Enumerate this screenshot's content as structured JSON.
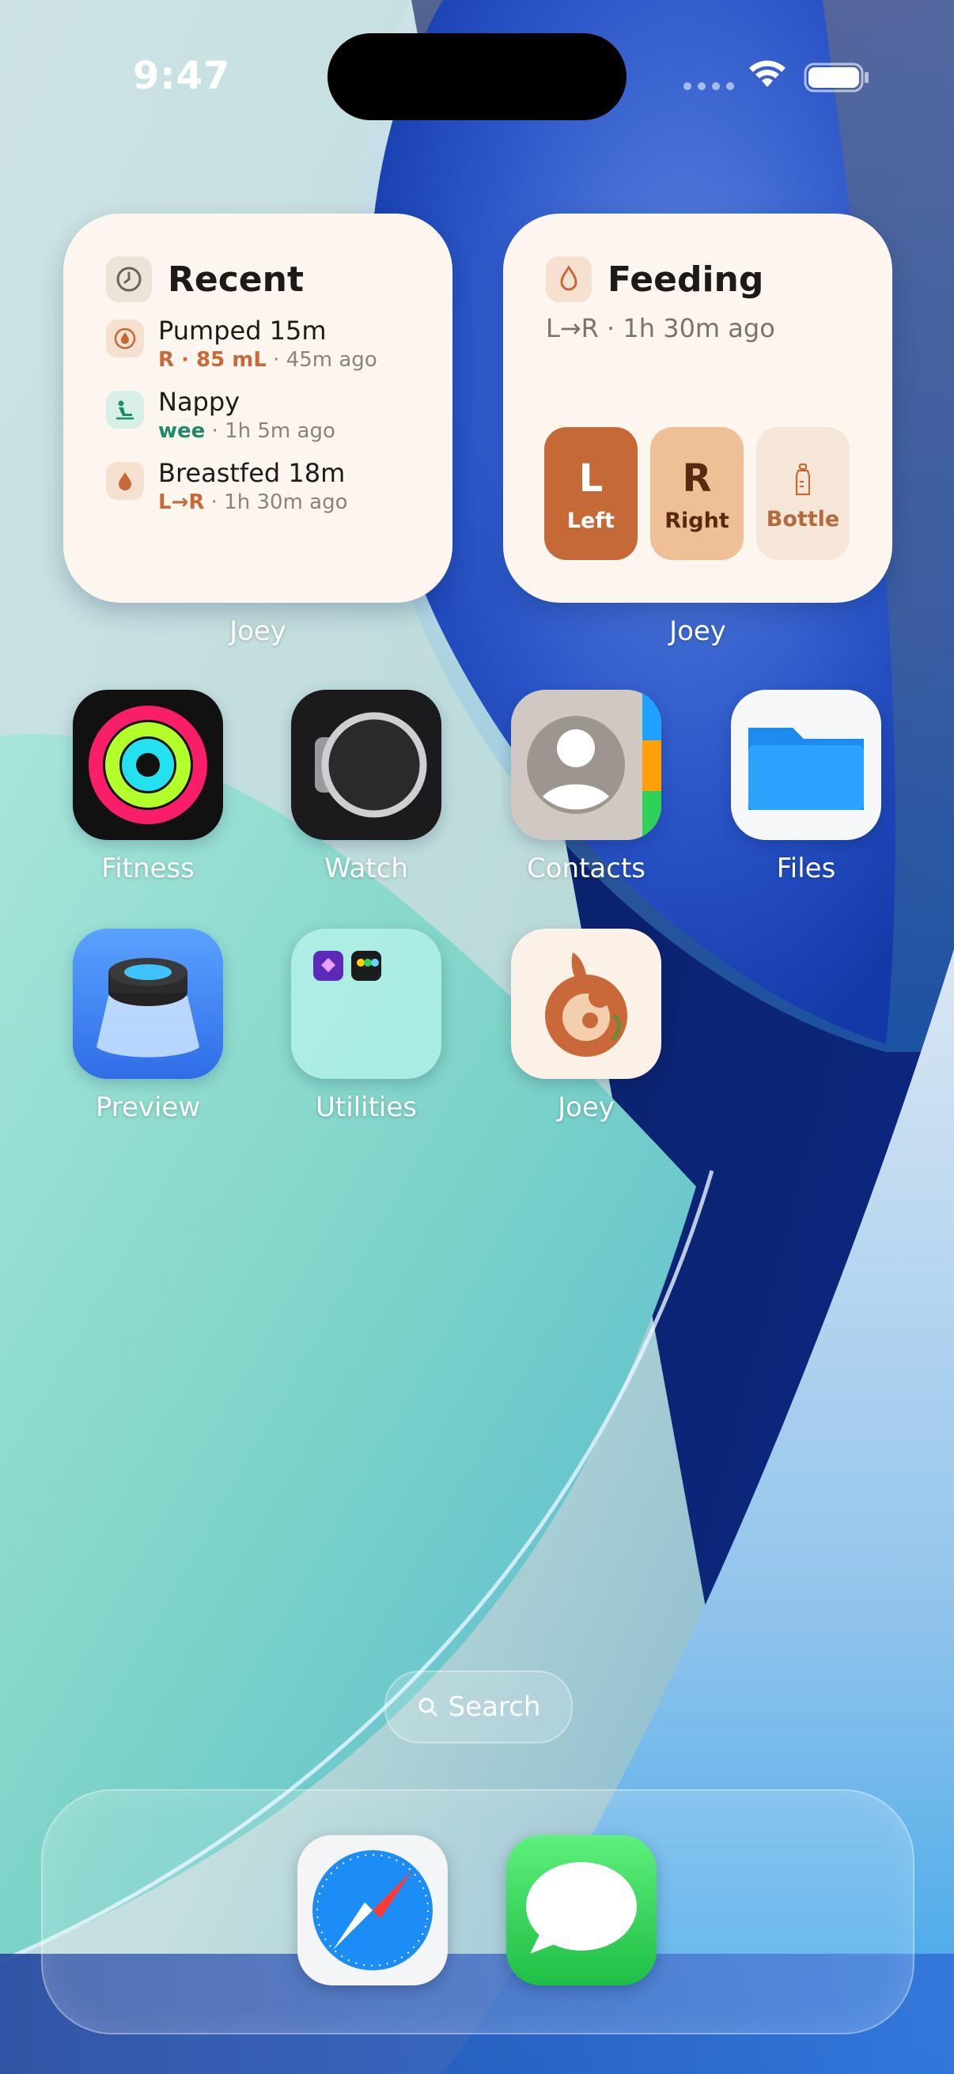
{
  "status_bar": {
    "time": "9:47"
  },
  "widgets": {
    "recent": {
      "title": "Recent",
      "owner": "Joey",
      "items": [
        {
          "title": "Pumped 15m",
          "accent": "R · 85 mL",
          "meta": " · 45m ago",
          "icon": "pump-drop-icon"
        },
        {
          "title": "Nappy",
          "accent": "wee",
          "meta": " · 1h 5m ago",
          "icon": "nappy-change-icon"
        },
        {
          "title": "Breastfed 18m",
          "accent": "L→R",
          "meta": " · 1h 30m ago",
          "icon": "breast-drop-icon"
        }
      ]
    },
    "feeding": {
      "title": "Feeding",
      "owner": "Joey",
      "subtitle": "L→R · 1h 30m ago",
      "buttons": [
        {
          "letter": "L",
          "label": "Left"
        },
        {
          "letter": "R",
          "label": "Right"
        },
        {
          "letter": "",
          "label": "Bottle"
        }
      ]
    }
  },
  "apps": [
    {
      "name": "Fitness"
    },
    {
      "name": "Watch"
    },
    {
      "name": "Contacts"
    },
    {
      "name": "Files"
    },
    {
      "name": "Preview"
    },
    {
      "name": "Utilities"
    },
    {
      "name": "Joey"
    }
  ],
  "search": {
    "label": "Search"
  },
  "dock": {
    "apps": [
      "Safari",
      "Messages"
    ]
  },
  "colors": {
    "widget_bg": "#fcf6ee",
    "accent_orange": "#c56a37",
    "accent_green": "#1d8a6a"
  }
}
